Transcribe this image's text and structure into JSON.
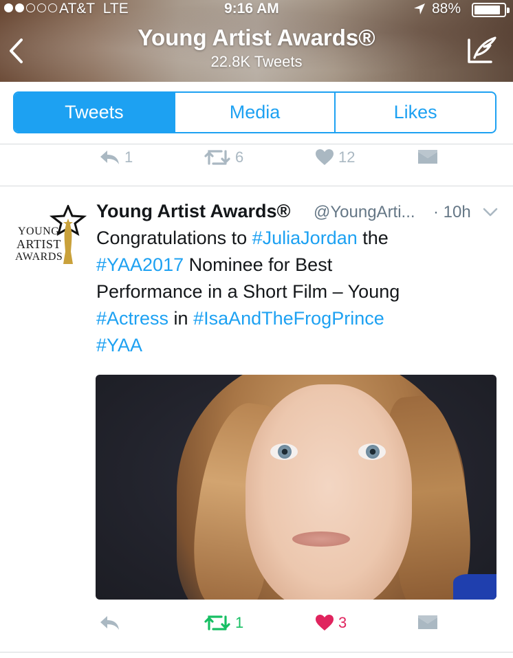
{
  "status_bar": {
    "carrier": "AT&T",
    "network": "LTE",
    "time": "9:16 AM",
    "battery": "88%",
    "battery_level": 0.88,
    "signal_bars": 2,
    "signal_total": 5
  },
  "header": {
    "title": "Young Artist Awards®",
    "subtitle": "22.8K Tweets",
    "back_icon": "chevron-left-icon",
    "compose_icon": "compose-icon"
  },
  "tabs": [
    {
      "label": "Tweets",
      "active": true
    },
    {
      "label": "Media",
      "active": false
    },
    {
      "label": "Likes",
      "active": false
    }
  ],
  "prev_tweet_actions": {
    "reply_count": "1",
    "retweet_count": "6",
    "like_count": "12"
  },
  "tweet": {
    "avatar": {
      "line1": "YOUNG",
      "line2": "ARTIST",
      "line3": "AWARDS"
    },
    "author_name": "Young Artist Awards®",
    "handle": "@YoungArti...",
    "time": "· 10h",
    "body": {
      "l1_a": "Congratulations to ",
      "l1_tag": "#JuliaJordan",
      "l1_b": " the",
      "l2_tag": "#YAA2017",
      "l2_b": " Nominee for Best",
      "l3": "Performance in a Short Film – Young",
      "l4_tag1": "#Actress",
      "l4_b": " in ",
      "l4_tag2": "#IsaAndTheFrogPrince",
      "l5_tag": "#YAA"
    },
    "actions": {
      "retweet_count": "1",
      "like_count": "3"
    }
  },
  "colors": {
    "accent": "#1da1f2",
    "retweet_active": "#17bf63",
    "like_active": "#e0245e",
    "icon_muted": "#aab8c2"
  }
}
